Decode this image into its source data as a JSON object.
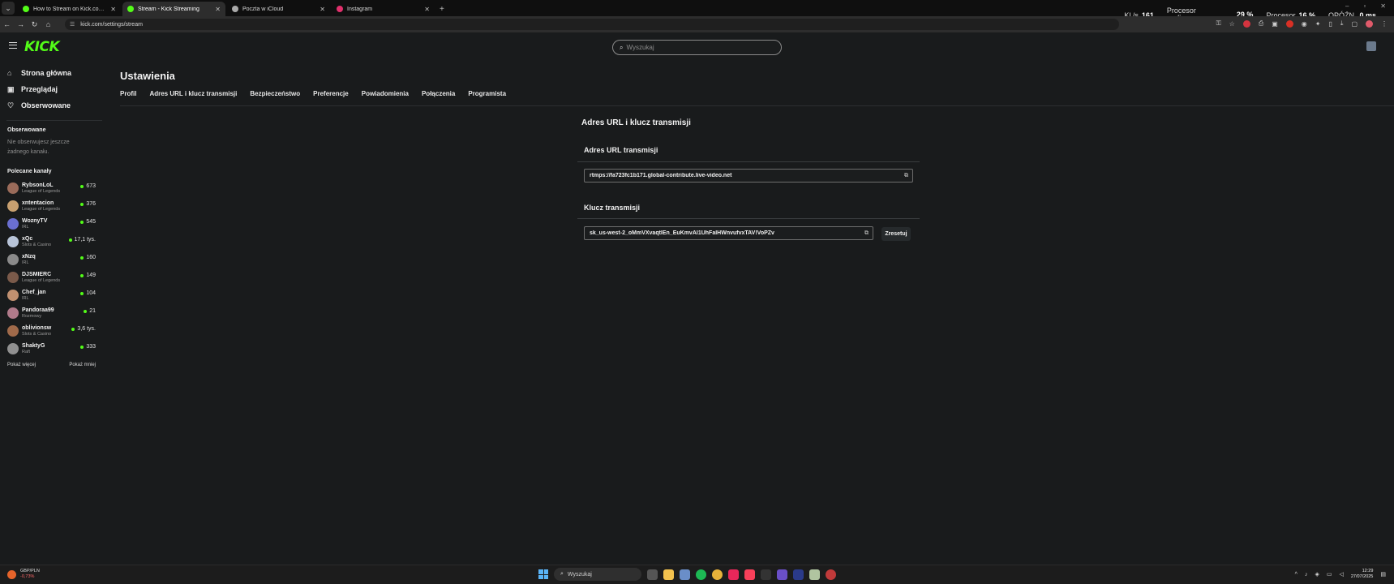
{
  "browser": {
    "tabs": [
      {
        "label": "How to Stream on Kick.com | K",
        "fav_color": "#53fc18",
        "active": false
      },
      {
        "label": "Stream - Kick Streaming",
        "fav_color": "#53fc18",
        "active": true
      },
      {
        "label": "Poczta w iCloud",
        "fav_color": "#aaaaaa",
        "active": false
      },
      {
        "label": "Instagram",
        "fav_color": "#e1306c",
        "active": false
      }
    ],
    "url": "kick.com/settings/stream"
  },
  "hwmon": {
    "fps_label": "Kl./s",
    "fps_value": "161",
    "gpu_label_1": "Procesor",
    "gpu_label_2": "graficzny",
    "gpu_value": "29 %",
    "cpu_label": "Procesor",
    "cpu_value": "16 %",
    "lat_label": "OPÓŹN.",
    "lat_value": "0 ms"
  },
  "search": {
    "placeholder": "Wyszukaj"
  },
  "sidebar": {
    "nav": [
      {
        "label": "Strona główna",
        "icon": "home-icon"
      },
      {
        "label": "Przeglądaj",
        "icon": "browse-icon"
      },
      {
        "label": "Obserwowane",
        "icon": "heart-icon"
      }
    ],
    "following_title": "Obserwowane",
    "following_empty": "Nie obserwujesz jeszcze żadnego kanału.",
    "recommended_title": "Polecane kanały",
    "channels": [
      {
        "name": "RybsonLoL",
        "category": "League of Legends",
        "viewers": "673",
        "color": "#9a6b5a"
      },
      {
        "name": "xntentacion",
        "category": "League of Legends",
        "viewers": "376",
        "color": "#c8a070"
      },
      {
        "name": "WoznyTV",
        "category": "IRL",
        "viewers": "545",
        "color": "#6a6fd0"
      },
      {
        "name": "xQc",
        "category": "Slots & Casino",
        "viewers": "17,1 tys.",
        "color": "#b8c4d8"
      },
      {
        "name": "xNzq",
        "category": "IRL",
        "viewers": "160",
        "color": "#8a8a8a"
      },
      {
        "name": "DJSMIERC",
        "category": "League of Legends",
        "viewers": "149",
        "color": "#7a5a4a"
      },
      {
        "name": "Chef_jan",
        "category": "IRL",
        "viewers": "104",
        "color": "#c09070"
      },
      {
        "name": "Pandoraa99",
        "category": "Rozmowy",
        "viewers": "21",
        "color": "#b07a8a"
      },
      {
        "name": "oblivionsw",
        "category": "Slots & Casino",
        "viewers": "3,6 tys.",
        "color": "#a06a4a"
      },
      {
        "name": "ShaktyG",
        "category": "Raft",
        "viewers": "333",
        "color": "#909090"
      }
    ],
    "show_more": "Pokaż więcej",
    "show_less": "Pokaż mniej"
  },
  "settings": {
    "title": "Ustawienia",
    "tabs": [
      "Profil",
      "Adres URL i klucz transmisji",
      "Bezpieczeństwo",
      "Preferencje",
      "Powiadomienia",
      "Połączenia",
      "Programista"
    ],
    "section_title": "Adres URL i klucz transmisji",
    "url_title": "Adres URL transmisji",
    "url_value": "rtmps://fa723fc1b171.global-contribute.live-video.net",
    "key_title": "Klucz transmisji",
    "key_value": "sk_us-west-2_oMmVXvaqtlEn_EuKmvAl1UhFalHWnvufvxTAV!VoPZv",
    "reset_label": "Zresetuj"
  },
  "taskbar": {
    "ticker_name": "GBP/PLN",
    "ticker_value": "-0,73%",
    "search_label": "Wyszukaj",
    "time": "12:29",
    "date": "27/07/2025"
  },
  "colors": {
    "accent": "#53fc18",
    "bg": "#191b1c"
  }
}
